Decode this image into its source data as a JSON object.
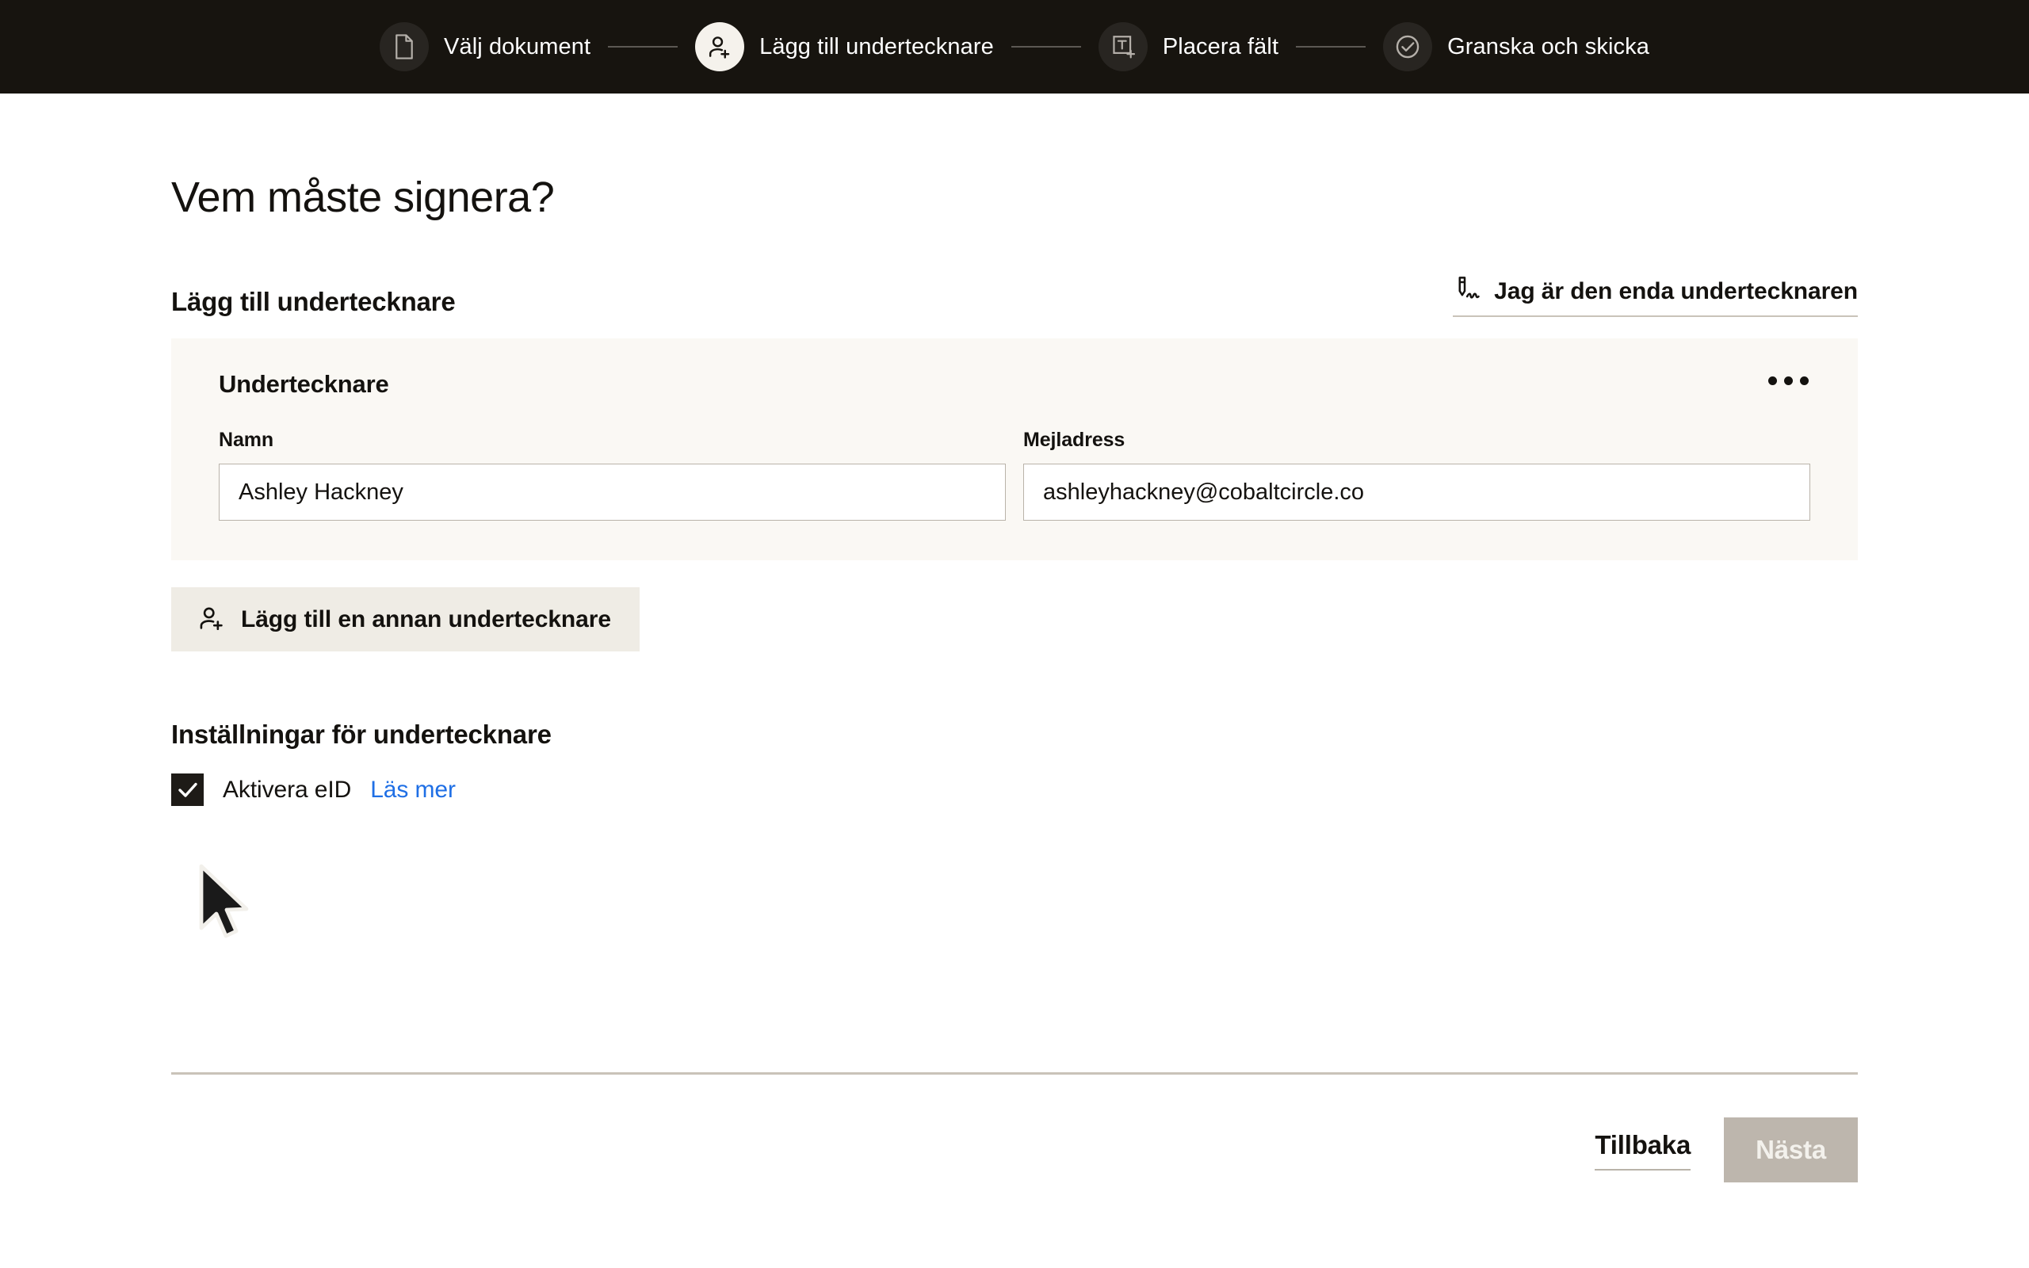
{
  "stepper": {
    "steps": [
      {
        "label": "Välj dokument",
        "icon": "document-icon",
        "state": "inactive"
      },
      {
        "label": "Lägg till undertecknare",
        "icon": "person-add-icon",
        "state": "active"
      },
      {
        "label": "Placera fält",
        "icon": "text-field-icon",
        "state": "inactive"
      },
      {
        "label": "Granska och skicka",
        "icon": "check-circle-icon",
        "state": "inactive"
      }
    ]
  },
  "main": {
    "page_title": "Vem måste signera?",
    "section_title": "Lägg till undertecknare",
    "only_signer_label": "Jag är den enda undertecknaren",
    "only_signer_icon": "signature-pen-icon",
    "signer_card": {
      "title": "Undertecknare",
      "menu_icon": "more-options-icon",
      "fields": [
        {
          "label": "Namn",
          "value": "Ashley Hackney",
          "placeholder": "Namn"
        },
        {
          "label": "Mejladress",
          "value": "ashleyhackney@cobaltcircle.co",
          "placeholder": "Mejladress"
        }
      ]
    },
    "add_signer_label": "Lägg till en annan undertecknare",
    "add_signer_icon": "person-add-icon",
    "settings_title": "Inställningar för undertecknare",
    "eid_checkbox": {
      "label": "Aktivera eID",
      "checked": true,
      "link_label": "Läs mer",
      "link_color": "#1f6fe5"
    }
  },
  "footer": {
    "back_label": "Tillbaka",
    "next_label": "Nästa",
    "next_disabled": true
  },
  "colors": {
    "topbar_bg": "#17140f",
    "card_bg": "#faf8f4",
    "button_bg": "#efece5",
    "accent_link": "#1f6fe5",
    "disabled_button": "#bdb6ad",
    "text": "#14120f"
  }
}
